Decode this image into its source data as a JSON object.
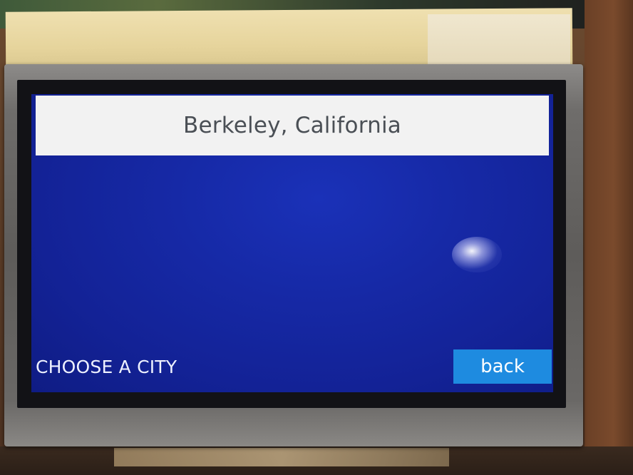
{
  "screen": {
    "title": "Berkeley, California",
    "footer_label": "CHOOSE A CITY",
    "back_label": "back"
  },
  "colors": {
    "screen_background": "#1629a6",
    "title_bar": "#f2f2f2",
    "back_button": "#1e8be0",
    "bezel": "#6f6d6b"
  }
}
